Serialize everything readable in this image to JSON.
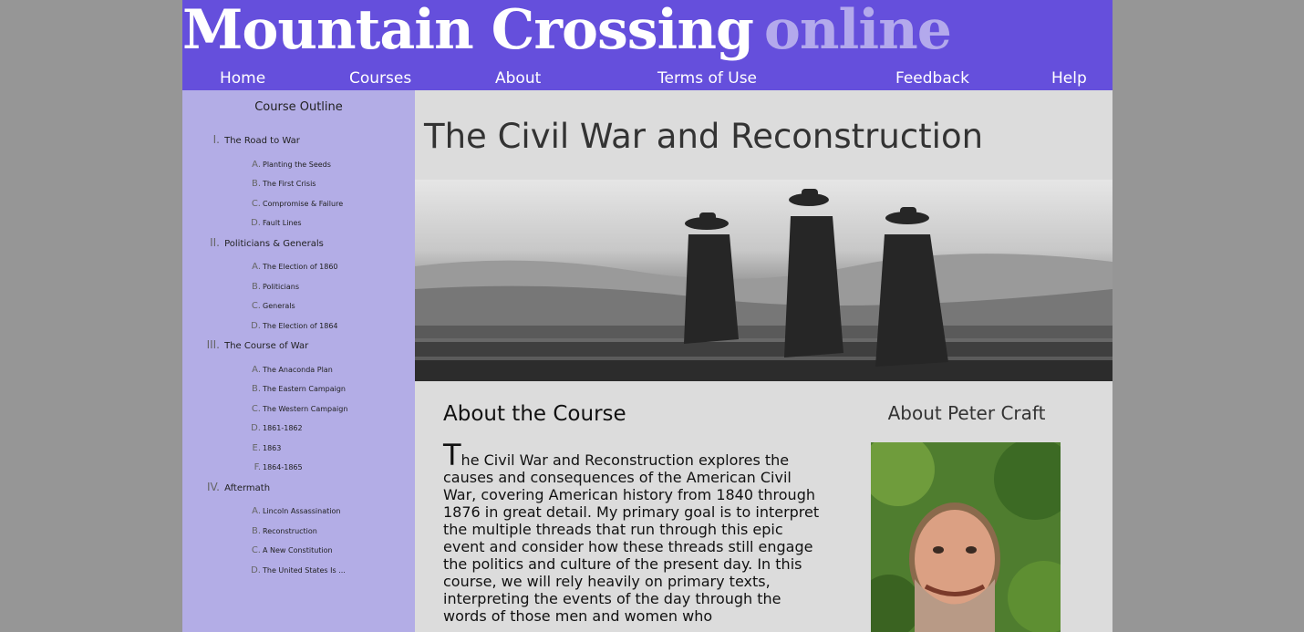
{
  "site": {
    "brand_main": "Mountain Crossing",
    "brand_suffix": "online"
  },
  "nav": [
    "Home",
    "Courses",
    "About",
    "Terms of Use",
    "Feedback",
    "Help"
  ],
  "sidebar": {
    "title": "Course Outline",
    "sections": [
      {
        "num": "I.",
        "label": "The Road to War",
        "items": [
          {
            "num": "A.",
            "label": "Planting the Seeds"
          },
          {
            "num": "B.",
            "label": "The First Crisis"
          },
          {
            "num": "C.",
            "label": "Compromise & Failure"
          },
          {
            "num": "D.",
            "label": "Fault Lines"
          }
        ]
      },
      {
        "num": "II.",
        "label": "Politicians & Generals",
        "items": [
          {
            "num": "A.",
            "label": "The Election of 1860"
          },
          {
            "num": "B.",
            "label": "Politicians"
          },
          {
            "num": "C.",
            "label": "Generals"
          },
          {
            "num": "D.",
            "label": "The Election of 1864"
          }
        ]
      },
      {
        "num": "III.",
        "label": "The Course of War",
        "items": [
          {
            "num": "A.",
            "label": "The Anaconda Plan"
          },
          {
            "num": "B.",
            "label": "The Eastern Campaign"
          },
          {
            "num": "C.",
            "label": "The Western Campaign"
          },
          {
            "num": "D.",
            "label": "1861-1862"
          },
          {
            "num": "E.",
            "label": "1863"
          },
          {
            "num": "F.",
            "label": "1864-1865"
          }
        ]
      },
      {
        "num": "IV.",
        "label": "Aftermath",
        "items": [
          {
            "num": "A.",
            "label": "Lincoln Assassination"
          },
          {
            "num": "B.",
            "label": "Reconstruction"
          },
          {
            "num": "C.",
            "label": "A New Constitution"
          },
          {
            "num": "D.",
            "label": "The United States Is ..."
          }
        ]
      }
    ]
  },
  "main": {
    "title": "The Civil War and Reconstruction",
    "about_heading": "About the Course",
    "about_dropcap": "T",
    "about_text": "he Civil War and Reconstruction explores the causes and consequences of the American Civil War, covering American history from 1840 through 1876 in great detail. My primary goal is to interpret the multiple threads that run through this epic event and consider how these threads still engage the politics and culture of the present day. In this course, we will rely heavily on primary texts, interpreting the events of the day through the words of those men and women who",
    "author_heading": "About Peter Craft"
  },
  "colors": {
    "header": "#654fdc",
    "sidebar": "#b3ade6",
    "content": "#dcdcdc",
    "backdrop": "#969696"
  }
}
